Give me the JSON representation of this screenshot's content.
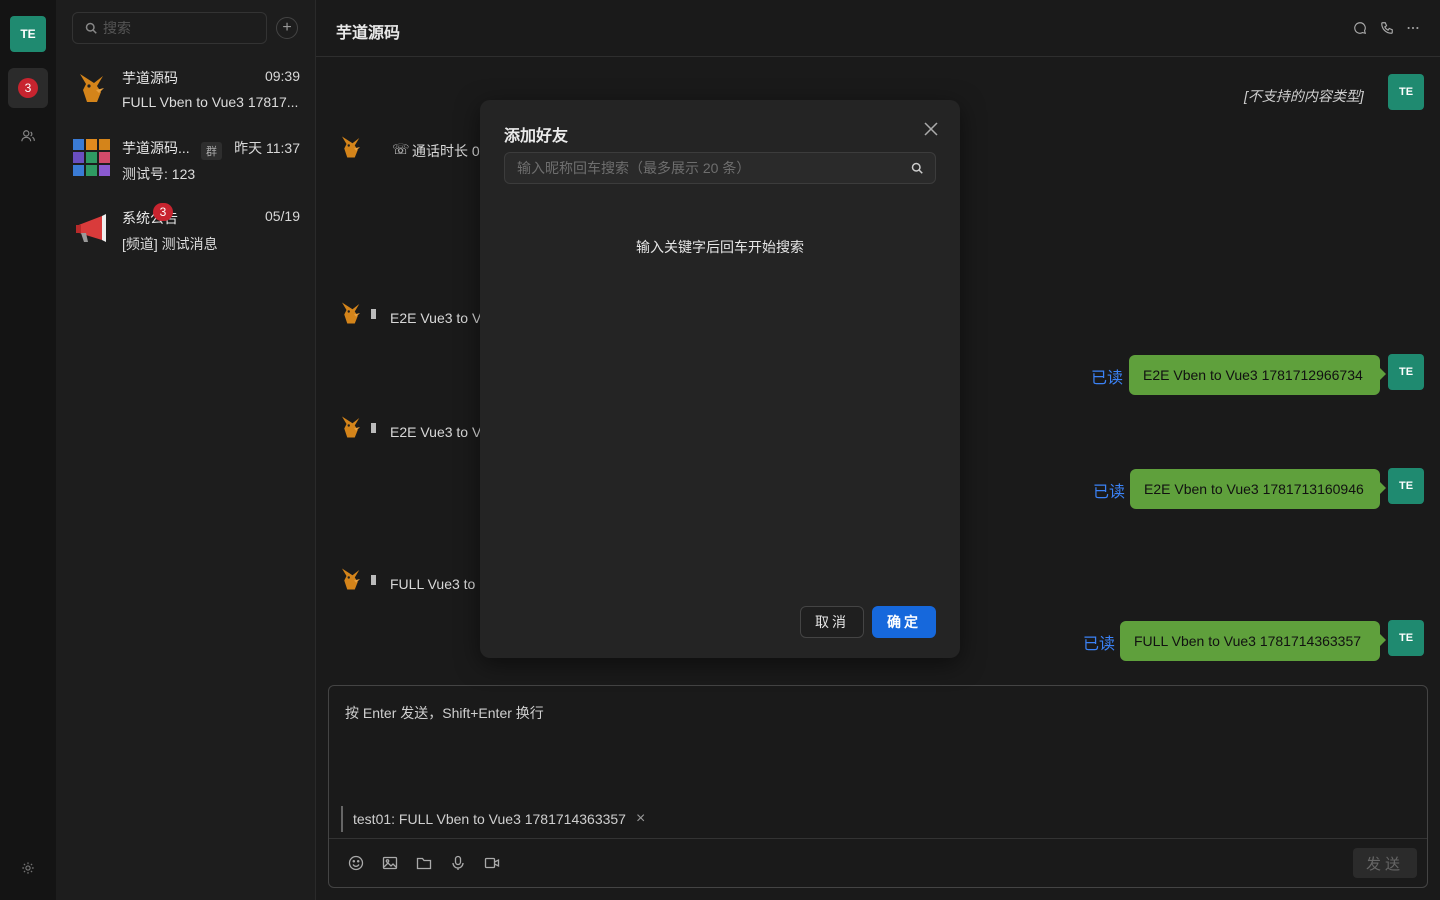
{
  "rail": {
    "me_initials": "TE",
    "chat_unread": "3",
    "icons": [
      "chat-icon",
      "contacts-icon",
      "settings-icon"
    ]
  },
  "sidebar": {
    "search_placeholder": "搜索",
    "add_label": "+",
    "conversations": [
      {
        "name": "芋道源码",
        "time": "09:39",
        "preview": "FULL Vben to Vue3 17817..."
      },
      {
        "name": "芋道源码...",
        "tag": "群",
        "time": "昨天 11:37",
        "preview": "测试号: 123"
      },
      {
        "name": "系统公告",
        "time": "05/19",
        "preview": "[频道] 测试消息",
        "badge": "3"
      }
    ]
  },
  "chat": {
    "title": "芋道源码",
    "header_icons": [
      "message-icon",
      "phone-icon",
      "more-icon"
    ],
    "unsupported": "[不支持的内容类型]",
    "other_messages": [
      "通话时长 0",
      "E2E Vue3 to V",
      "E2E Vue3 to V",
      "FULL Vue3 to"
    ],
    "my_messages": [
      {
        "text": "E2E Vben to Vue3 1781712966734",
        "status": "已读"
      },
      {
        "text": "E2E Vben to Vue3 1781713160946",
        "status": "已读"
      },
      {
        "text": "FULL Vben to Vue3 1781714363357",
        "status": "已读"
      }
    ],
    "my_initials": "TE"
  },
  "composer": {
    "placeholder": "按 Enter 发送，Shift+Enter 换行",
    "quote": "test01: FULL Vben to Vue3 1781714363357",
    "quote_close": "×",
    "send_label": "发送",
    "tools": [
      "emoji-icon",
      "image-icon",
      "folder-icon",
      "mic-icon",
      "video-icon"
    ]
  },
  "modal": {
    "title": "添加好友",
    "search_placeholder": "输入昵称回车搜索（最多展示 20 条）",
    "hint": "输入关键字后回车开始搜索",
    "cancel_label": "取消",
    "ok_label": "确定"
  },
  "colors": {
    "accent": "#1668dc",
    "bubble": "#5fa03c",
    "avatar": "#1f8a70",
    "badge": "#c8242f",
    "read": "#3b82f6"
  }
}
